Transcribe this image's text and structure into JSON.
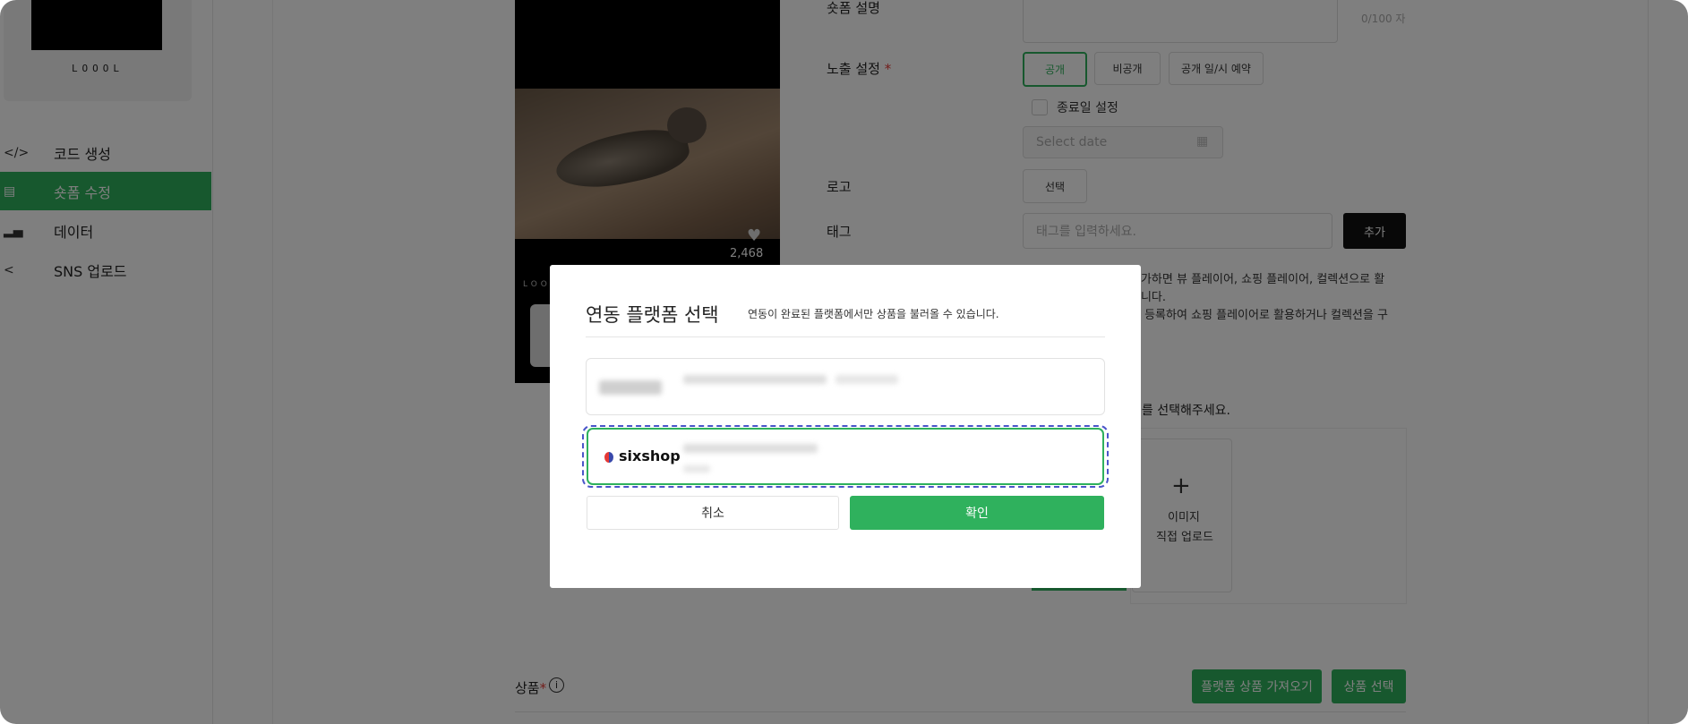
{
  "sidebar": {
    "brand_word": "LOOOL",
    "items": [
      {
        "icon": "code-icon",
        "glyph": "</>",
        "label": "코드 생성",
        "active": false
      },
      {
        "icon": "document-icon",
        "glyph": "▤",
        "label": "숏폼 수정",
        "active": true
      },
      {
        "icon": "bar-chart-icon",
        "glyph": "▂▄",
        "label": "데이터",
        "active": false
      },
      {
        "icon": "share-icon",
        "glyph": "<",
        "label": "SNS 업로드",
        "active": false
      }
    ]
  },
  "preview": {
    "likes": "2,468",
    "logo_word": "LOOOL"
  },
  "form": {
    "desc_label": "숏폼 설명",
    "desc_counter": "0/100 자",
    "exposure_label": "노출 설정",
    "required_mark": "*",
    "exposure_options": [
      "공개",
      "비공개",
      "공개 일/시 예약"
    ],
    "end_date_checkbox": "종료일 설정",
    "date_placeholder": "Select date",
    "logo_label": "로고",
    "logo_button": "선택",
    "tag_label": "태그",
    "tag_placeholder": "태그를 입력하세요.",
    "tag_add": "추가",
    "info_line1": "추가하면 뷰 플레이어, 쇼핑 플레이어, 컬렉션으로 활",
    "info_line2": "습니다.",
    "info_line3": "을 등록하여 쇼핑 플레이어로 활용하거나 컬렉션을 구",
    "thumb_instruction": "지를 선택해주세요.",
    "upload_plus": "+",
    "upload_line1": "이미지",
    "upload_line2": "직접 업로드",
    "product_label": "상품",
    "import_button": "플랫폼 상품 가져오기",
    "select_product_button": "상품 선택"
  },
  "modal": {
    "title": "연동 플랫폼 선택",
    "subtitle": "연동이 완료된 플랫폼에서만 상품을 불러올 수 있습니다.",
    "option2_brand": "sixshop",
    "cancel": "취소",
    "confirm": "확인"
  },
  "colors": {
    "accent": "#2fb15d",
    "focus_ring": "#4a55c9",
    "overlay": "rgba(0,0,0,0.5)"
  }
}
